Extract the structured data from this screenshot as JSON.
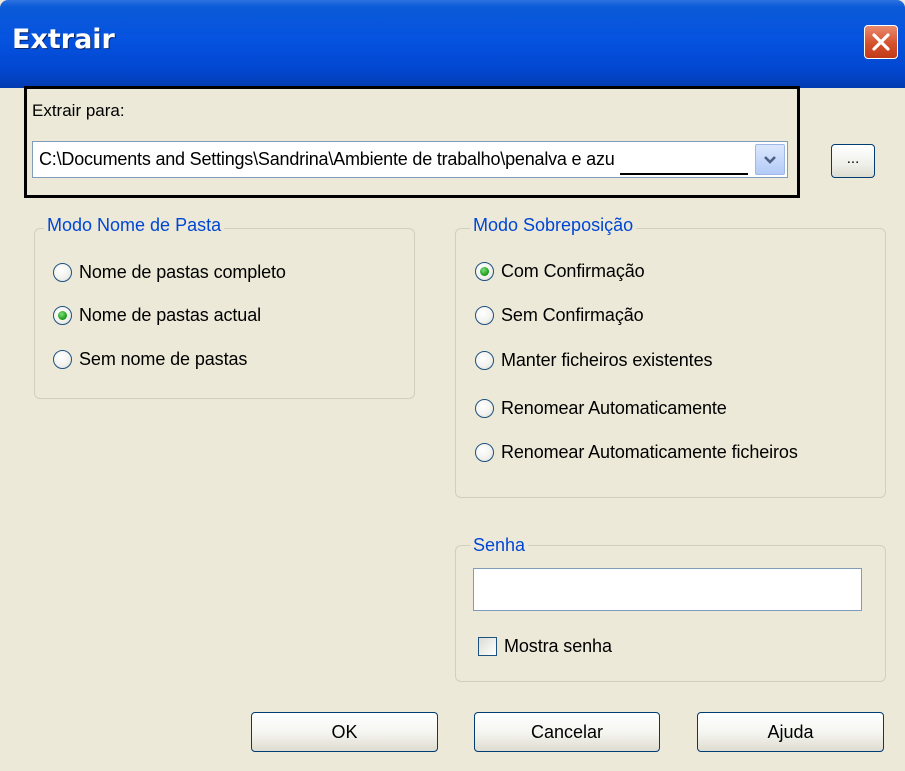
{
  "window": {
    "title": "Extrair"
  },
  "extract_to": {
    "label": "Extrair para:",
    "path_value": "C:\\Documents and Settings\\Sandrina\\Ambiente de trabalho\\penalva e azu",
    "browse_label": "..."
  },
  "folder_mode": {
    "legend": "Modo Nome de Pasta",
    "options": [
      {
        "label": "Nome de pastas completo",
        "checked": false
      },
      {
        "label": "Nome de pastas actual",
        "checked": true
      },
      {
        "label": "Sem nome de pastas",
        "checked": false
      }
    ]
  },
  "overwrite_mode": {
    "legend": "Modo Sobreposição",
    "options": [
      {
        "label": "Com Confirmação",
        "checked": true
      },
      {
        "label": "Sem Confirmação",
        "checked": false
      },
      {
        "label": "Manter ficheiros existentes",
        "checked": false
      },
      {
        "label": "Renomear Automaticamente",
        "checked": false
      },
      {
        "label": "Renomear Automaticamente ficheiros",
        "checked": false
      }
    ]
  },
  "password": {
    "legend": "Senha",
    "value": "",
    "show_label": "Mostra senha",
    "show_checked": false
  },
  "buttons": {
    "ok": "OK",
    "cancel": "Cancelar",
    "help": "Ajuda"
  },
  "colors": {
    "title_bar": "#0553e0",
    "group_legend": "#0046d5",
    "radio_checked": "#21a121"
  }
}
